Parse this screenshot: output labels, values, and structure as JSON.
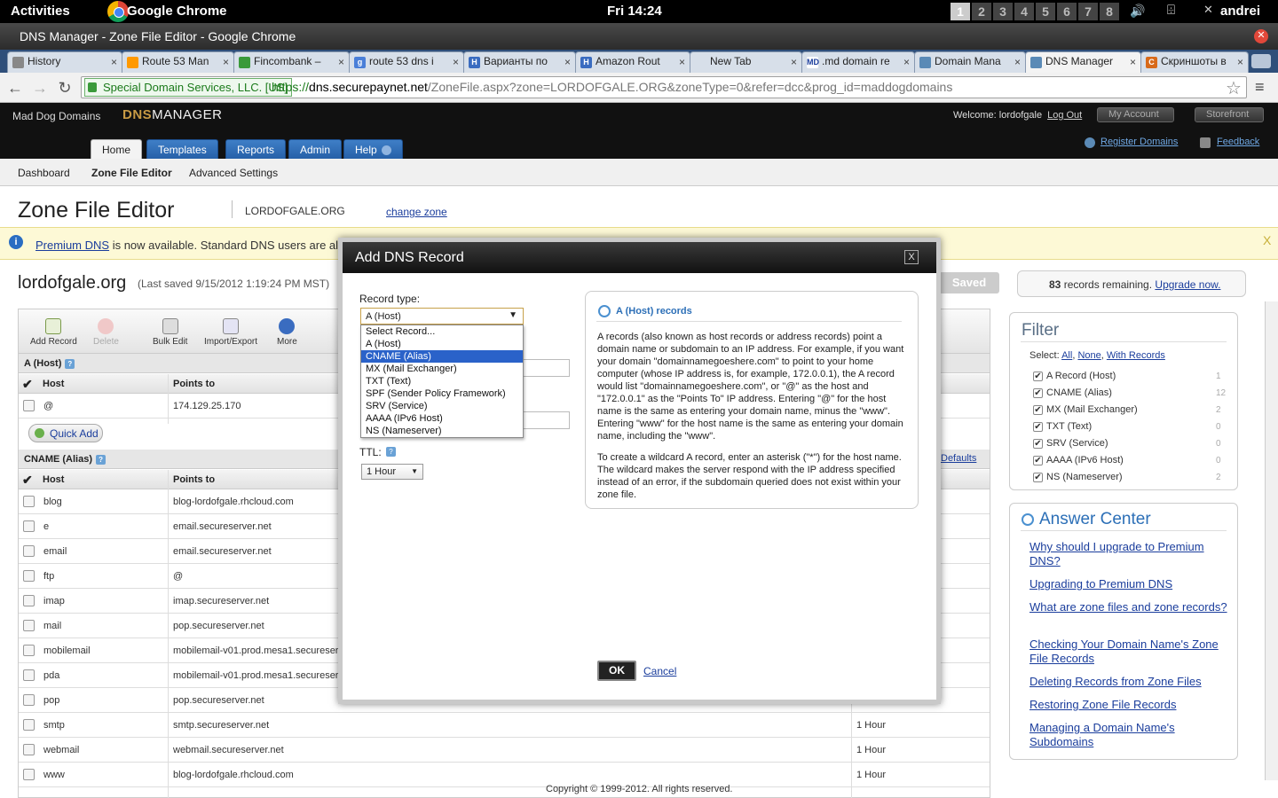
{
  "gnome": {
    "activities": "Activities",
    "app": "Google Chrome",
    "clock": "Fri 14:24",
    "workspaces": [
      "1",
      "2",
      "3",
      "4",
      "5",
      "6",
      "7",
      "8"
    ],
    "user": "andrei",
    "volume_icon": "speaker-icon",
    "network_icon": "network-icon"
  },
  "window": {
    "title": "DNS Manager - Zone File Editor - Google Chrome",
    "close": "✕"
  },
  "tabs": [
    {
      "label": "History",
      "icon": "history-icon"
    },
    {
      "label": "Route 53 Man",
      "icon": "aws-icon"
    },
    {
      "label": "Fincombank –",
      "icon": "doc-icon"
    },
    {
      "label": "route 53 dns i",
      "icon": "google-icon"
    },
    {
      "label": "Варианты по",
      "icon": "h-icon"
    },
    {
      "label": "Amazon Rout",
      "icon": "h-icon"
    },
    {
      "label": "New Tab",
      "icon": ""
    },
    {
      "label": ".md domain re",
      "icon": "md-icon"
    },
    {
      "label": "Domain Mana",
      "icon": "site-icon"
    },
    {
      "label": "DNS Manager",
      "icon": "site-icon"
    },
    {
      "label": "Скриншоты в",
      "icon": "c-icon"
    }
  ],
  "tab_close": "×",
  "tab_icon_letters": {
    "google": "g",
    "h": "H",
    "md": "MD",
    "c": "C"
  },
  "omnibox": {
    "ssl_label": "Special Domain Services, LLC. [US]",
    "url_scheme": "https://",
    "url_host": "dns.securepaynet.net",
    "url_path": "/ZoneFile.aspx?zone=LORDOFGALE.ORG&zoneType=0&refer=dcc&prog_id=maddogdomains",
    "star": "☆",
    "menu": "≡"
  },
  "nav": {
    "back": "←",
    "forward": "→",
    "reload": "↻"
  },
  "site": {
    "brand": "Mad Dog Domains",
    "logo_dns": "DNS",
    "logo_manager": "MANAGER",
    "welcome": "Welcome: lordofgale",
    "logout": "Log Out",
    "my_account": "My Account",
    "storefront": "Storefront",
    "main_tabs": [
      "Home",
      "Templates",
      "Reports",
      "Admin",
      "Help"
    ],
    "register": "Register Domains",
    "feedback": "Feedback",
    "subnav": [
      "Dashboard",
      "Zone File Editor",
      "Advanced Settings"
    ]
  },
  "page": {
    "title": "Zone File Editor",
    "domain": "LORDOFGALE.ORG",
    "change_zone": "change zone",
    "banner_link": "Premium DNS",
    "banner_text": " is now available. Standard DNS users are al",
    "banner_close": "X",
    "zone_domain": "lordofgale.org",
    "last_saved": "(Last saved 9/15/2012 1:19:24 PM MST)",
    "saved_btn": "Saved",
    "remaining_count": "83",
    "remaining_text": " records remaining. ",
    "upgrade": "Upgrade now.",
    "footer": "Copyright © 1999-2012. All rights reserved."
  },
  "toolbar": [
    "Add Record",
    "Delete",
    "Bulk Edit",
    "Import/Export",
    "More"
  ],
  "a_section": {
    "title": "A (Host)",
    "col_host": "Host",
    "col_points": "Points to",
    "rows": [
      {
        "host": "@",
        "points": "174.129.25.170"
      }
    ],
    "quick_add": "Quick Add"
  },
  "cname_section": {
    "title": "CNAME (Alias)",
    "col_host": "Host",
    "col_points": "Points to",
    "defaults": "Defaults",
    "rows": [
      {
        "host": "blog",
        "points": "blog-lordofgale.rhcloud.com",
        "ttl": ""
      },
      {
        "host": "e",
        "points": "email.secureserver.net",
        "ttl": ""
      },
      {
        "host": "email",
        "points": "email.secureserver.net",
        "ttl": ""
      },
      {
        "host": "ftp",
        "points": "@",
        "ttl": ""
      },
      {
        "host": "imap",
        "points": "imap.secureserver.net",
        "ttl": ""
      },
      {
        "host": "mail",
        "points": "pop.secureserver.net",
        "ttl": ""
      },
      {
        "host": "mobilemail",
        "points": "mobilemail-v01.prod.mesa1.secureser",
        "ttl": ""
      },
      {
        "host": "pda",
        "points": "mobilemail-v01.prod.mesa1.secureser",
        "ttl": ""
      },
      {
        "host": "pop",
        "points": "pop.secureserver.net",
        "ttl": ""
      },
      {
        "host": "smtp",
        "points": "smtp.secureserver.net",
        "ttl": "1 Hour"
      },
      {
        "host": "webmail",
        "points": "webmail.secureserver.net",
        "ttl": "1 Hour"
      },
      {
        "host": "www",
        "points": "blog-lordofgale.rhcloud.com",
        "ttl": "1 Hour"
      }
    ]
  },
  "filter": {
    "title": "Filter",
    "select_label": "Select: ",
    "all": "All",
    "none": "None",
    "with_records": "With Records",
    "items": [
      {
        "label": "A Record (Host)",
        "count": "1"
      },
      {
        "label": "CNAME (Alias)",
        "count": "12"
      },
      {
        "label": "MX (Mail Exchanger)",
        "count": "2"
      },
      {
        "label": "TXT (Text)",
        "count": "0"
      },
      {
        "label": "SRV (Service)",
        "count": "0"
      },
      {
        "label": "AAAA (IPv6 Host)",
        "count": "0"
      },
      {
        "label": "NS (Nameserver)",
        "count": "2"
      }
    ]
  },
  "answer_center": {
    "title": "Answer Center",
    "links": [
      "Why should I upgrade to Premium DNS?",
      "Upgrading to Premium DNS",
      "What are zone files and zone records?",
      "Checking Your Domain Name's Zone File Records",
      "Deleting Records from Zone Files",
      "Restoring Zone File Records",
      "Managing a Domain Name's Subdomains"
    ]
  },
  "modal": {
    "title": "Add DNS Record",
    "close": "X",
    "record_type_label": "Record type:",
    "selected": "A (Host)",
    "options": [
      "Select Record...",
      "A (Host)",
      "CNAME (Alias)",
      "MX (Mail Exchanger)",
      "TXT (Text)",
      "SPF (Sender Policy Framework)",
      "SRV (Service)",
      "AAAA (IPv6 Host)",
      "NS (Nameserver)"
    ],
    "highlighted_index": 2,
    "ttl_label": "TTL:",
    "ttl_value": "1 Hour",
    "help_title": "A (Host) records",
    "help_p1": "A records (also known as host records or address records) point a domain name or subdomain to an IP address. For example, if you want your domain \"domainnamegoeshere.com\" to point to your home computer (whose IP address is, for example, 172.0.0.1), the A record would list \"domainnamegoeshere.com\", or \"@\" as the host and \"172.0.0.1\" as the \"Points To\" IP address. Entering \"@\" for the host name is the same as entering your domain name, minus the \"www\". Entering \"www\" for the host name is the same as entering your domain name, including the \"www\".",
    "help_p2": "To create a wildcard A record, enter an asterisk (\"*\") for the host name. The wildcard makes the server respond with the IP address specified instead of an error, if the subdomain queried does not exist within your zone file.",
    "ok": "OK",
    "cancel": "Cancel"
  }
}
